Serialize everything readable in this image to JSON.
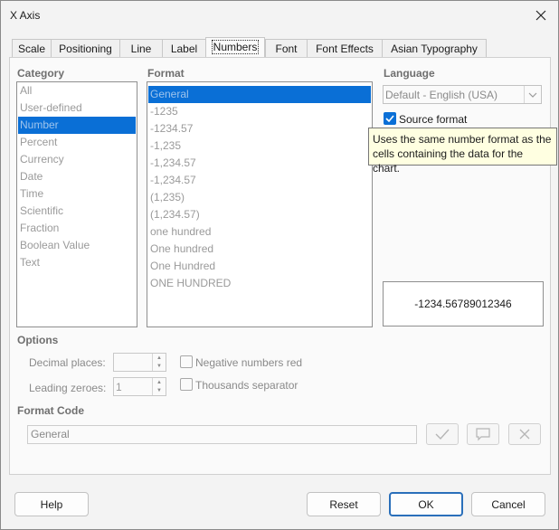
{
  "window": {
    "title": "X Axis"
  },
  "tabs": [
    {
      "label": "Scale"
    },
    {
      "label": "Positioning"
    },
    {
      "label": "Line"
    },
    {
      "label": "Label"
    },
    {
      "label": "Numbers"
    },
    {
      "label": "Font"
    },
    {
      "label": "Font Effects"
    },
    {
      "label": "Asian Typography"
    }
  ],
  "active_tab": "Numbers",
  "category": {
    "title": "Category",
    "items": [
      "All",
      "User-defined",
      "Number",
      "Percent",
      "Currency",
      "Date",
      "Time",
      "Scientific",
      "Fraction",
      "Boolean Value",
      "Text"
    ],
    "selected": "Number"
  },
  "format": {
    "title": "Format",
    "items": [
      "General",
      "-1235",
      "-1234.57",
      "-1,235",
      "-1,234.57",
      "-1,234.57",
      "(1,235)",
      "(1,234.57)",
      "one hundred",
      "One hundred",
      "One Hundred",
      "ONE HUNDRED"
    ],
    "selected": "General"
  },
  "language": {
    "title": "Language",
    "value": "Default - English (USA)"
  },
  "source_format": {
    "label": "Source format",
    "checked": true
  },
  "tooltip": {
    "text": "Uses the same number format as the cells containing the data for the chart."
  },
  "preview": {
    "value": "-1234.56789012346"
  },
  "options": {
    "title": "Options",
    "decimal_places_label": "Decimal places:",
    "decimal_places_value": "",
    "leading_zeroes_label": "Leading zeroes:",
    "leading_zeroes_value": "1",
    "negative_red_label": "Negative numbers red",
    "negative_red_checked": false,
    "thousands_label": "Thousands separator",
    "thousands_checked": false
  },
  "format_code": {
    "title": "Format Code",
    "value": "General"
  },
  "buttons": {
    "help": "Help",
    "reset": "Reset",
    "ok": "OK",
    "cancel": "Cancel"
  },
  "colors": {
    "accent": "#0a6fd6",
    "tooltip_bg": "#ffffe1"
  }
}
